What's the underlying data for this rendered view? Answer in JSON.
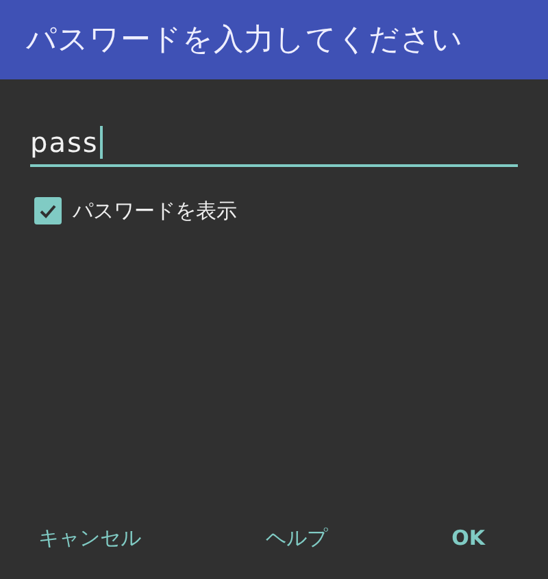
{
  "dialog": {
    "title": "パスワードを入力してください"
  },
  "password_field": {
    "value": "pass",
    "focused": true
  },
  "show_password": {
    "label": "パスワードを表示",
    "checked": true
  },
  "buttons": [
    {
      "label": "キャンセル"
    },
    {
      "label": "ヘルプ"
    },
    {
      "label": "OK"
    }
  ]
}
